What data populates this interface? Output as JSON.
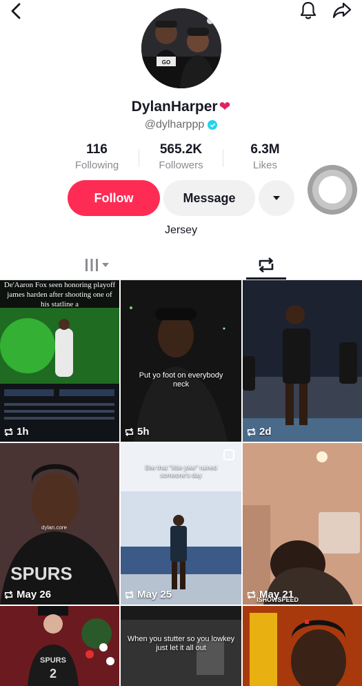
{
  "profile": {
    "name": "DylanHarper",
    "handle": "@dylharppp",
    "bio": "Jersey"
  },
  "stats": [
    {
      "value": "116",
      "label": "Following"
    },
    {
      "value": "565.2K",
      "label": "Followers"
    },
    {
      "value": "6.3M",
      "label": "Likes"
    }
  ],
  "actions": {
    "follow_label": "Follow",
    "message_label": "Message"
  },
  "colors": {
    "accent": "#fe2c55",
    "verified": "#20d5ec",
    "secondary_button": "#f1f1f2"
  },
  "icons": {
    "back": "chevron-left-icon",
    "notification": "bell-icon",
    "share": "share-arrow-icon",
    "heart": "red-heart-emoji",
    "verified": "verified-check-icon",
    "dropdown": "caret-down-icon",
    "videos_tab": "bars-grid-icon",
    "reposts_tab": "repost-icon"
  },
  "videos": [
    {
      "time": "1h",
      "caption": "De'Aaron Fox seen honoring playoff james harden after shooting one of his statline a"
    },
    {
      "time": "5h",
      "caption": "Put yo foot on everybody neck"
    },
    {
      "time": "2d",
      "caption": ""
    },
    {
      "time": "May 26",
      "caption": "dylan.core"
    },
    {
      "time": "May 25",
      "caption": "Btw that \"little joke\" ruined someone's day"
    },
    {
      "time": "May 21",
      "caption": "ISHOWSPEED"
    },
    {
      "time": "",
      "caption": ""
    },
    {
      "time": "",
      "caption": "When you stutter so you lowkey just let it all out"
    },
    {
      "time": "",
      "caption": ""
    }
  ]
}
